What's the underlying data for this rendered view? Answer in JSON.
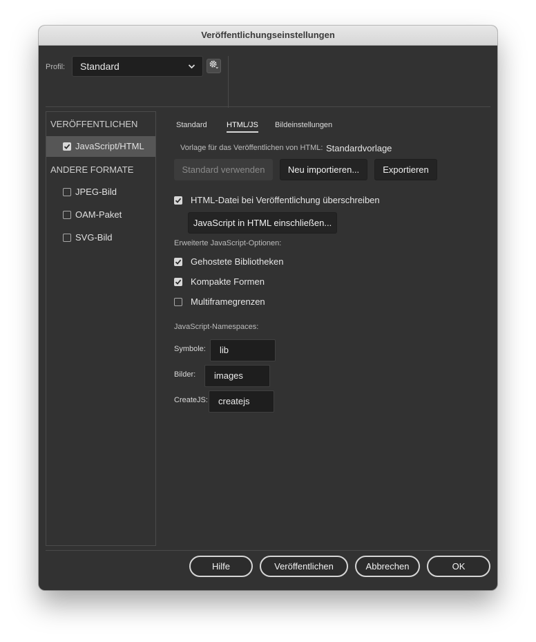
{
  "window": {
    "title": "Veröffentlichungseinstellungen"
  },
  "profile": {
    "label": "Profil:",
    "value": "Standard",
    "gear_icon": "gear-icon"
  },
  "sidebar": {
    "section_publish": "VERÖFFENTLICHEN",
    "section_other": "ANDERE FORMATE",
    "items": [
      {
        "label": "JavaScript/HTML",
        "checked": true,
        "selected": true
      },
      {
        "label": "JPEG-Bild",
        "checked": false
      },
      {
        "label": "OAM-Paket",
        "checked": false
      },
      {
        "label": "SVG-Bild",
        "checked": false
      }
    ]
  },
  "tabs": [
    {
      "label": "Standard",
      "active": false
    },
    {
      "label": "HTML/JS",
      "active": true
    },
    {
      "label": "Bildeinstellungen",
      "active": false
    }
  ],
  "template": {
    "label": "Vorlage für das Veröffentlichen von HTML:",
    "value": "Standardvorlage",
    "btn_default": "Standard verwenden",
    "btn_import": "Neu importieren...",
    "btn_export": "Exportieren"
  },
  "overwrite": {
    "label": "HTML-Datei bei Veröffentlichung überschreiben",
    "checked": true
  },
  "include_js_button": "JavaScript in HTML einschließen...",
  "advanced": {
    "heading": "Erweiterte JavaScript-Optionen:",
    "options": [
      {
        "label": "Gehostete Bibliotheken",
        "checked": true
      },
      {
        "label": "Kompakte Formen",
        "checked": true
      },
      {
        "label": "Multiframegrenzen",
        "checked": false
      }
    ]
  },
  "namespaces": {
    "heading": "JavaScript-Namespaces:",
    "symbols": {
      "label": "Symbole:",
      "value": "lib"
    },
    "images": {
      "label": "Bilder:",
      "value": "images"
    },
    "createjs": {
      "label": "CreateJS:",
      "value": "createjs"
    }
  },
  "footer": {
    "help": "Hilfe",
    "publish": "Veröffentlichen",
    "cancel": "Abbrechen",
    "ok": "OK"
  },
  "colors": {
    "background": "#323232",
    "field": "#1e1e1e",
    "selection": "#565656",
    "titlebar": "#dedede"
  }
}
